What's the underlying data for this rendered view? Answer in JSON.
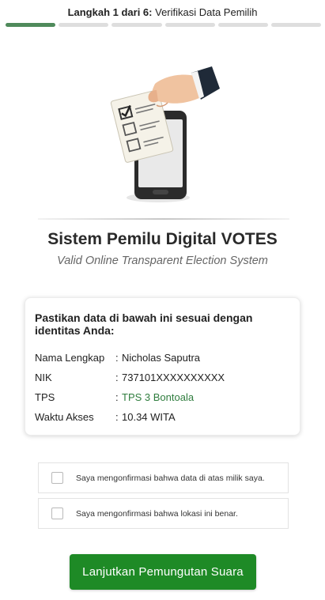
{
  "progress": {
    "step_label": "Langkah 1 dari 6:",
    "step_title": "Verifikasi Data Pemilih",
    "current_step": 1,
    "total_steps": 6,
    "active_color": "#4f8a5b",
    "inactive_color": "#dedede"
  },
  "illustration": {
    "icon": "phone-voting-ballot-illustration"
  },
  "header": {
    "title": "Sistem Pemilu Digital VOTES",
    "subtitle": "Valid Online Transparent Election System"
  },
  "voter_card": {
    "heading": "Pastikan data di bawah ini sesuai dengan identitas Anda:",
    "fields": [
      {
        "label": "Nama Lengkap",
        "value": "Nicholas Saputra"
      },
      {
        "label": "NIK",
        "value": "737101XXXXXXXXXX"
      },
      {
        "label": "TPS",
        "value": "TPS 3 Bontoala"
      },
      {
        "label": "Waktu Akses",
        "value": "10.34 WITA"
      }
    ],
    "colon": ":"
  },
  "confirmations": [
    {
      "label": "Saya mengonfirmasi bahwa data di atas milik saya.",
      "checked": false
    },
    {
      "label": "Saya mengonfirmasi bahwa lokasi ini benar.",
      "checked": false
    }
  ],
  "cta": {
    "label": "Lanjutkan Pemungutan Suara",
    "color": "#1e8a26"
  }
}
